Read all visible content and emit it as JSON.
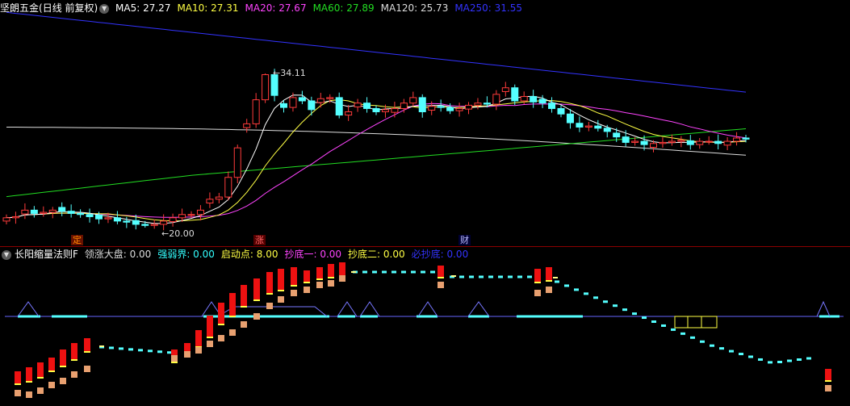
{
  "main_chart": {
    "stock_name": "坚朗五金",
    "period_label": "(日线 前复权)",
    "ma": [
      {
        "label": "MA5: ",
        "value": "27.27",
        "color": "#ffffff"
      },
      {
        "label": "MA10: ",
        "value": "27.31",
        "color": "#ffff44"
      },
      {
        "label": "MA20: ",
        "value": "27.67",
        "color": "#ff44ff"
      },
      {
        "label": "MA60: ",
        "value": "27.89",
        "color": "#22dd22"
      },
      {
        "label": "MA120: ",
        "value": "25.73",
        "color": "#dddddd"
      },
      {
        "label": "MA250: ",
        "value": "31.55",
        "color": "#3333ff"
      }
    ],
    "high_marker": "34.11",
    "low_marker": "20.00",
    "event_tags": [
      {
        "text": "定",
        "color": "#ff8800",
        "bg": "#661100"
      },
      {
        "text": "涨",
        "color": "#ff6666",
        "bg": "#550000"
      },
      {
        "text": "财",
        "color": "#bbbbff",
        "bg": "#000033"
      }
    ]
  },
  "indicator": {
    "name": "长阳缩量法则F",
    "fields": [
      {
        "label": "领涨大盘: ",
        "value": "0.00",
        "color": "#dddddd"
      },
      {
        "label": "强弱界: ",
        "value": "0.00",
        "color": "#33ffff"
      },
      {
        "label": "启动点: ",
        "value": "8.00",
        "color": "#ffff44"
      },
      {
        "label": "抄底一: ",
        "value": "0.00",
        "color": "#ff44ff"
      },
      {
        "label": "抄底二: ",
        "value": "0.00",
        "color": "#ffff44"
      },
      {
        "label": "必抄底: ",
        "value": "0.00",
        "color": "#3333ff"
      }
    ]
  },
  "colors": {
    "up": "#ff3b3b",
    "down": "#54ffff",
    "ma5": "#ffffff",
    "ma10": "#ffff44",
    "ma20": "#ff44ff",
    "ma60": "#22dd22",
    "ma120": "#dddddd",
    "ma250": "#3333ff"
  }
}
